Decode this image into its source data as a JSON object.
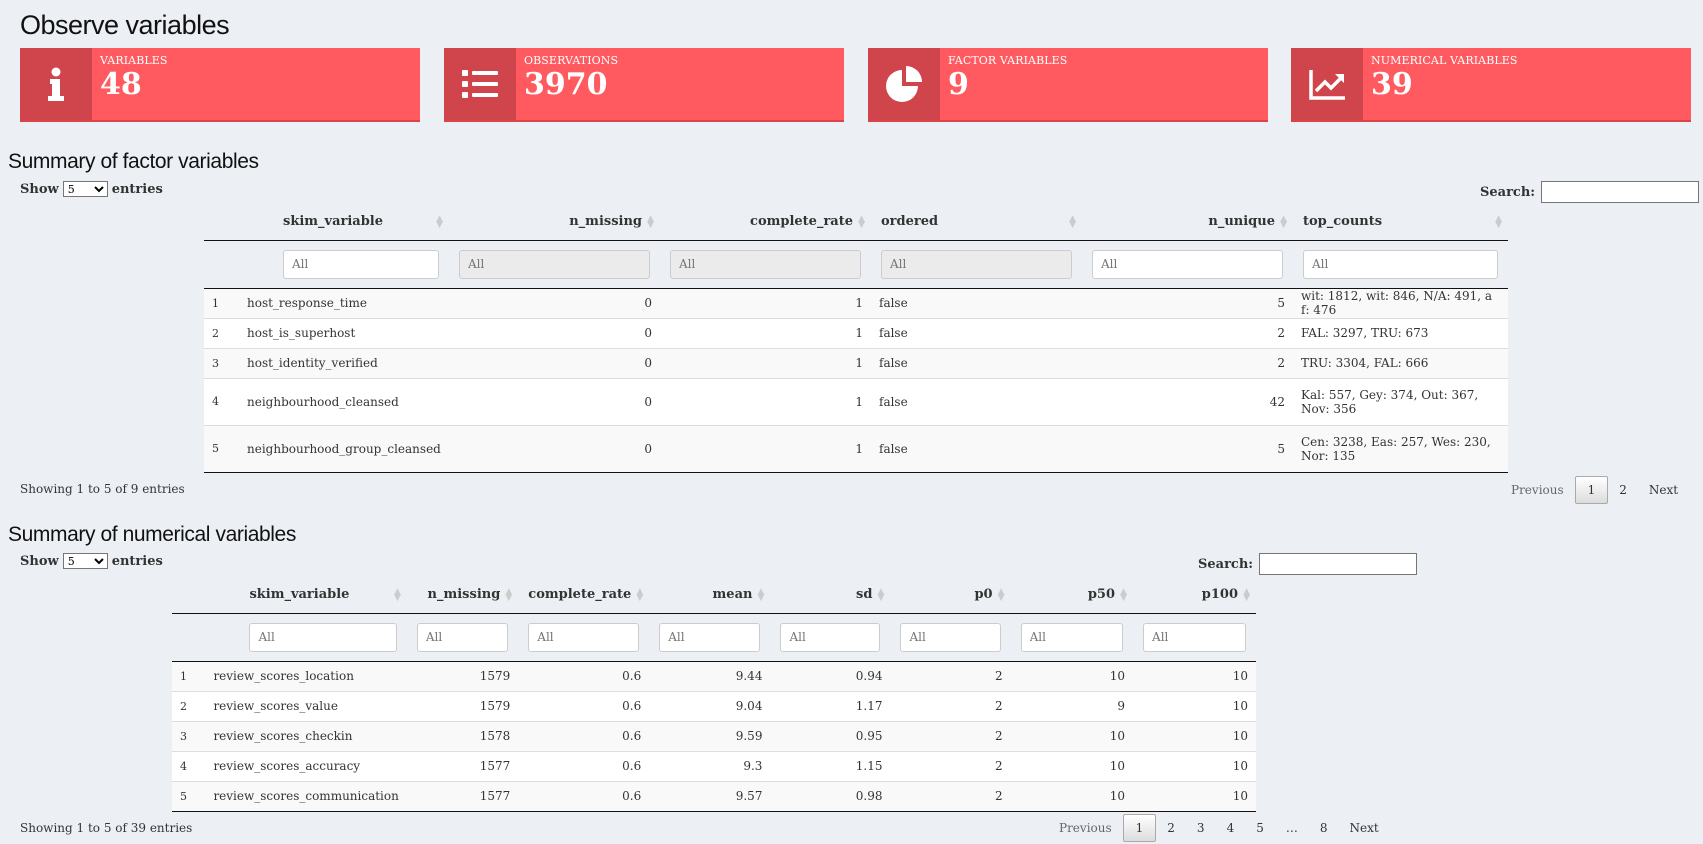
{
  "page_title": "Observe variables",
  "value_boxes": [
    {
      "label": "VARIABLES",
      "value": "48",
      "icon": "info-icon"
    },
    {
      "label": "OBSERVATIONS",
      "value": "3970",
      "icon": "list-icon"
    },
    {
      "label": "FACTOR VARIABLES",
      "value": "9",
      "icon": "pie-chart-icon"
    },
    {
      "label": "NUMERICAL VARIABLES",
      "value": "39",
      "icon": "line-chart-icon"
    }
  ],
  "factor": {
    "title": "Summary of factor variables",
    "show_label": "Show",
    "entries_label": "entries",
    "length_value": "5",
    "search_label": "Search:",
    "filter_placeholder": "All",
    "columns": [
      "skim_variable",
      "n_missing",
      "complete_rate",
      "ordered",
      "n_unique",
      "top_counts"
    ],
    "rows": [
      [
        "1",
        "host_response_time",
        "0",
        "1",
        "false",
        "5",
        "wit: 1812, wit: 846, N/A: 491, a f: 476"
      ],
      [
        "2",
        "host_is_superhost",
        "0",
        "1",
        "false",
        "2",
        "FAL: 3297, TRU: 673"
      ],
      [
        "3",
        "host_identity_verified",
        "0",
        "1",
        "false",
        "2",
        "TRU: 3304, FAL: 666"
      ],
      [
        "4",
        "neighbourhood_cleansed",
        "0",
        "1",
        "false",
        "42",
        "Kal: 557, Gey: 374, Out: 367, Nov: 356"
      ],
      [
        "5",
        "neighbourhood_group_cleansed",
        "0",
        "1",
        "false",
        "5",
        "Cen: 3238, Eas: 257, Wes: 230, Nor: 135"
      ]
    ],
    "info": "Showing 1 to 5 of 9 entries",
    "pager": {
      "previous": "Previous",
      "pages": [
        "1",
        "2"
      ],
      "next": "Next"
    }
  },
  "numerical": {
    "title": "Summary of numerical variables",
    "show_label": "Show",
    "entries_label": "entries",
    "length_value": "5",
    "search_label": "Search:",
    "filter_placeholder": "All",
    "columns": [
      "skim_variable",
      "n_missing",
      "complete_rate",
      "mean",
      "sd",
      "p0",
      "p50",
      "p100"
    ],
    "rows": [
      [
        "1",
        "review_scores_location",
        "1579",
        "0.6",
        "9.44",
        "0.94",
        "2",
        "10",
        "10"
      ],
      [
        "2",
        "review_scores_value",
        "1579",
        "0.6",
        "9.04",
        "1.17",
        "2",
        "9",
        "10"
      ],
      [
        "3",
        "review_scores_checkin",
        "1578",
        "0.6",
        "9.59",
        "0.95",
        "2",
        "10",
        "10"
      ],
      [
        "4",
        "review_scores_accuracy",
        "1577",
        "0.6",
        "9.3",
        "1.15",
        "2",
        "10",
        "10"
      ],
      [
        "5",
        "review_scores_communication",
        "1577",
        "0.6",
        "9.57",
        "0.98",
        "2",
        "10",
        "10"
      ]
    ],
    "info": "Showing 1 to 5 of 39 entries",
    "pager": {
      "previous": "Previous",
      "pages": [
        "1",
        "2",
        "3",
        "4",
        "5",
        "…",
        "8"
      ],
      "next": "Next"
    }
  }
}
